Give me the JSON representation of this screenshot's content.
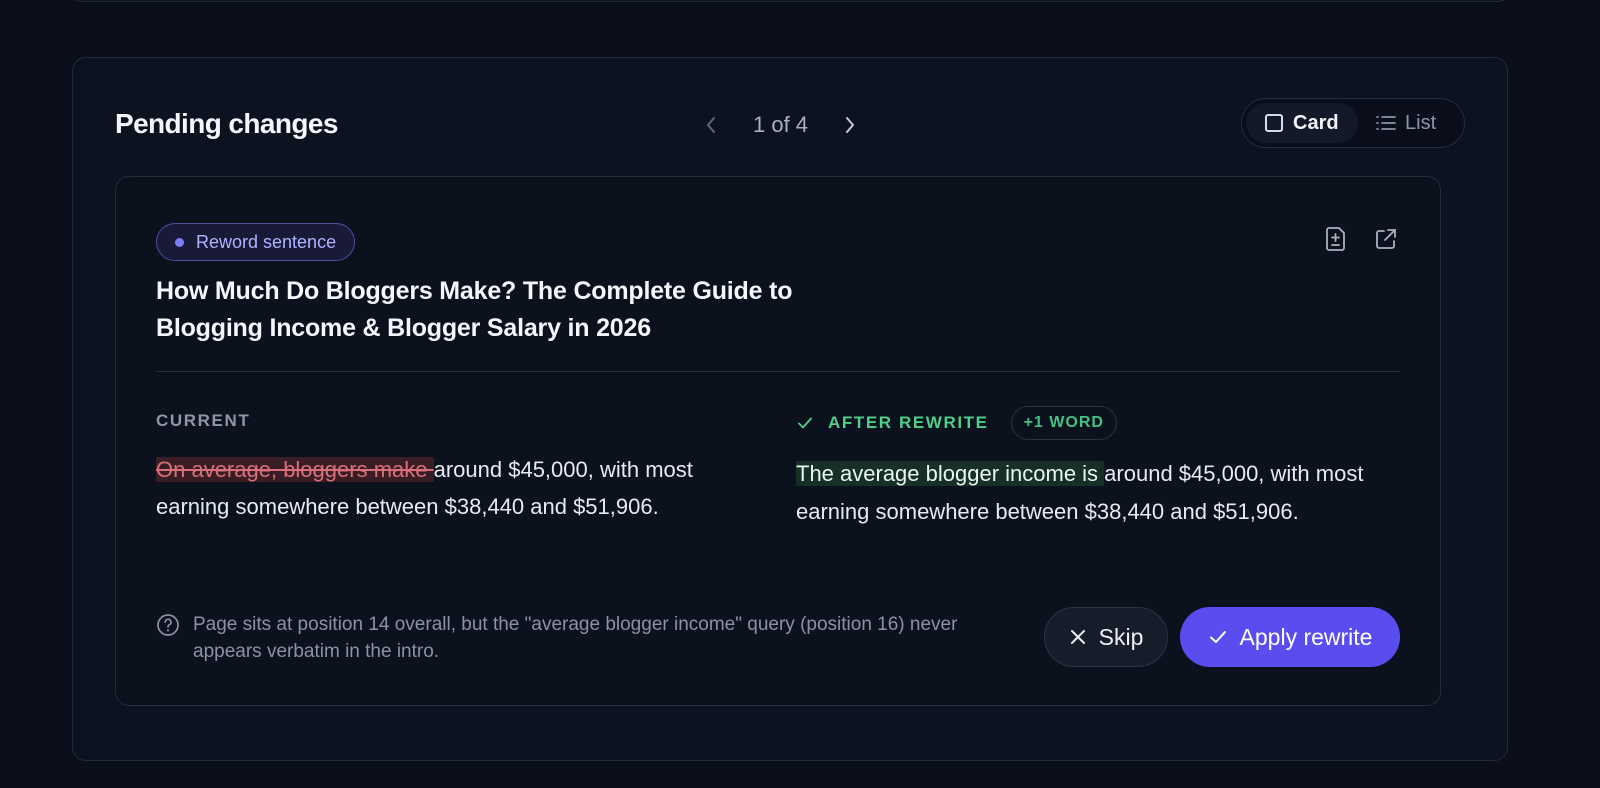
{
  "panel": {
    "title": "Pending changes",
    "pager": {
      "count_text": "1 of 4"
    },
    "view_toggle": {
      "card_label": "Card",
      "list_label": "List",
      "selected": "Card"
    }
  },
  "change": {
    "badge_label": "Reword sentence",
    "article_title": "How Much Do Bloggers Make? The Complete Guide to Blogging Income & Blogger Salary in 2026",
    "current": {
      "label": "CURRENT",
      "removed_text": "On average, bloggers make ",
      "unchanged_text": "around $45,000, with most earning somewhere between $38,440 and $51,906."
    },
    "after": {
      "label": "AFTER REWRITE",
      "word_delta": "+1 WORD",
      "added_text": "The average blogger income is ",
      "unchanged_text": "around $45,000, with most earning somewhere between $38,440 and $51,906."
    },
    "note": "Page sits at position 14 overall, but the \"average blogger income\" query (position 16) never appears verbatim in the intro.",
    "skip_label": "Skip",
    "apply_label": "Apply rewrite"
  },
  "colors": {
    "background": "#0b0f1b",
    "accent": "#5a4df0",
    "badge_text": "#aeb4ff",
    "success": "#4fcf8a",
    "deletion_bg": "#3a1c24",
    "deletion_text": "#d77078",
    "insertion_bg": "#163028"
  },
  "icons": {
    "prev": "chevron-left-icon",
    "next": "chevron-right-icon",
    "card_view": "square-icon",
    "list_view": "list-icon",
    "diff_document": "file-diff-icon",
    "open_external": "external-link-icon",
    "check": "check-icon",
    "help": "question-circle-icon",
    "close": "x-icon"
  }
}
